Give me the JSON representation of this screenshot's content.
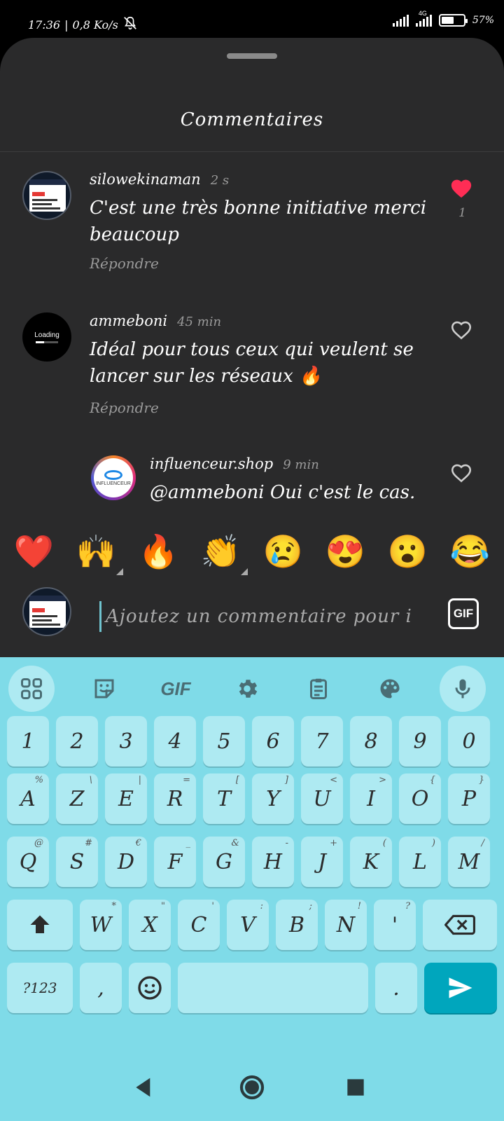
{
  "status_bar": {
    "time": "17:36",
    "speed": "0,8 Ko/s",
    "network_label": "4G",
    "battery": "57%",
    "battery_level": 0.57
  },
  "sheet": {
    "title": "Commentaires"
  },
  "comments": [
    {
      "username": "silowekinaman",
      "time": "2 s",
      "text": "C'est une très bonne initiative merci beaucoup",
      "reply_label": "Répondre",
      "liked": true,
      "like_count": "1"
    },
    {
      "username": "ammeboni",
      "time": "45 min",
      "text": "Idéal pour tous ceux qui veulent se lancer sur les réseaux 🔥",
      "reply_label": "Répondre",
      "liked": false,
      "avatar_text": "Loading"
    },
    {
      "username": "influenceur.shop",
      "time": "9 min",
      "text": "@ammeboni Oui c'est le cas.",
      "liked": false,
      "avatar_text": "INFLUENCEUR"
    }
  ],
  "emoji_bar": [
    "❤️",
    "🙌",
    "🔥",
    "👏",
    "😢",
    "😍",
    "😮",
    "😂"
  ],
  "input": {
    "placeholder": "Ajoutez un commentaire pour i",
    "gif_label": "GIF"
  },
  "keyboard": {
    "toolbar_gif": "GIF",
    "number_row": [
      "1",
      "2",
      "3",
      "4",
      "5",
      "6",
      "7",
      "8",
      "9",
      "0"
    ],
    "row1": [
      {
        "key": "A",
        "alt": "%"
      },
      {
        "key": "Z",
        "alt": "\\"
      },
      {
        "key": "E",
        "alt": "|"
      },
      {
        "key": "R",
        "alt": "="
      },
      {
        "key": "T",
        "alt": "["
      },
      {
        "key": "Y",
        "alt": "]"
      },
      {
        "key": "U",
        "alt": "<"
      },
      {
        "key": "I",
        "alt": ">"
      },
      {
        "key": "O",
        "alt": "{"
      },
      {
        "key": "P",
        "alt": "}"
      }
    ],
    "row2": [
      {
        "key": "Q",
        "alt": "@"
      },
      {
        "key": "S",
        "alt": "#"
      },
      {
        "key": "D",
        "alt": "€"
      },
      {
        "key": "F",
        "alt": "_"
      },
      {
        "key": "G",
        "alt": "&"
      },
      {
        "key": "H",
        "alt": "-"
      },
      {
        "key": "J",
        "alt": "+"
      },
      {
        "key": "K",
        "alt": "("
      },
      {
        "key": "L",
        "alt": ")"
      },
      {
        "key": "M",
        "alt": "/"
      }
    ],
    "row3": [
      {
        "key": "W",
        "alt": "*"
      },
      {
        "key": "X",
        "alt": "\""
      },
      {
        "key": "C",
        "alt": "'"
      },
      {
        "key": "V",
        "alt": ":"
      },
      {
        "key": "B",
        "alt": ";"
      },
      {
        "key": "N",
        "alt": "!"
      },
      {
        "key": "'",
        "alt": "?"
      }
    ],
    "symbols_label": "?123",
    "comma": ",",
    "period": "."
  },
  "colors": {
    "sheet_bg": "#2a2a2b",
    "keyboard_bg": "#7fdbe8",
    "key_bg": "#aeeaf2",
    "send_key": "#00a6bd",
    "like_active": "#ff2d55"
  }
}
